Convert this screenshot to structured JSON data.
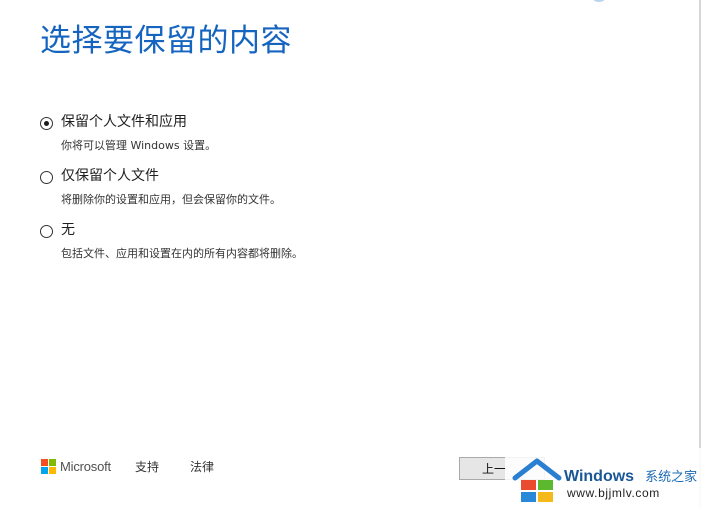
{
  "title": "选择要保留的内容",
  "options": [
    {
      "label": "保留个人文件和应用",
      "description": "你将可以管理 Windows 设置。",
      "selected": true
    },
    {
      "label": "仅保留个人文件",
      "description": "将删除你的设置和应用，但会保留你的文件。",
      "selected": false
    },
    {
      "label": "无",
      "description": "包括文件、应用和设置在内的所有内容都将删除。",
      "selected": false
    }
  ],
  "footer": {
    "brand": "Microsoft",
    "links": [
      "支持",
      "法律"
    ]
  },
  "buttons": {
    "back_label": "上一"
  },
  "watermark": {
    "title": "Windows",
    "subtitle": "系统之家",
    "url": "www.bjjmlv.com"
  },
  "colors": {
    "title": "#1565c0",
    "ms_red": "#f25022",
    "ms_green": "#7fba00",
    "ms_blue": "#00a4ef",
    "ms_yellow": "#ffb900"
  },
  "icons": {
    "brand": "microsoft-logo-icon",
    "watermark": "windows-house-logo-icon"
  }
}
